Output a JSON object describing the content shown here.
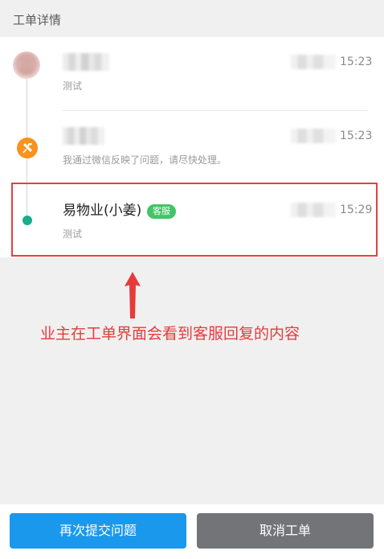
{
  "header": {
    "title": "工单详情"
  },
  "timeline": {
    "entries": [
      {
        "time": "15:23",
        "message": "测试",
        "icon": "avatar"
      },
      {
        "time": "15:23",
        "message": "我通过微信反映了问题，请尽快处理。",
        "icon": "tools-icon"
      },
      {
        "name": "易物业(小姜)",
        "badge": "客服",
        "time": "15:29",
        "message": "测试",
        "icon": "dot"
      }
    ]
  },
  "annotation": {
    "text": "业主在工单界面会看到客服回复的内容"
  },
  "actions": {
    "resubmit_label": "再次提交问题",
    "cancel_label": "取消工单"
  },
  "colors": {
    "accent_blue": "#1a98ec",
    "secondary_gray": "#737478",
    "badge_green": "#42c468",
    "timeline_green": "#1aad8e",
    "tool_orange": "#f7931e",
    "annotation_red": "#e53b3b"
  }
}
